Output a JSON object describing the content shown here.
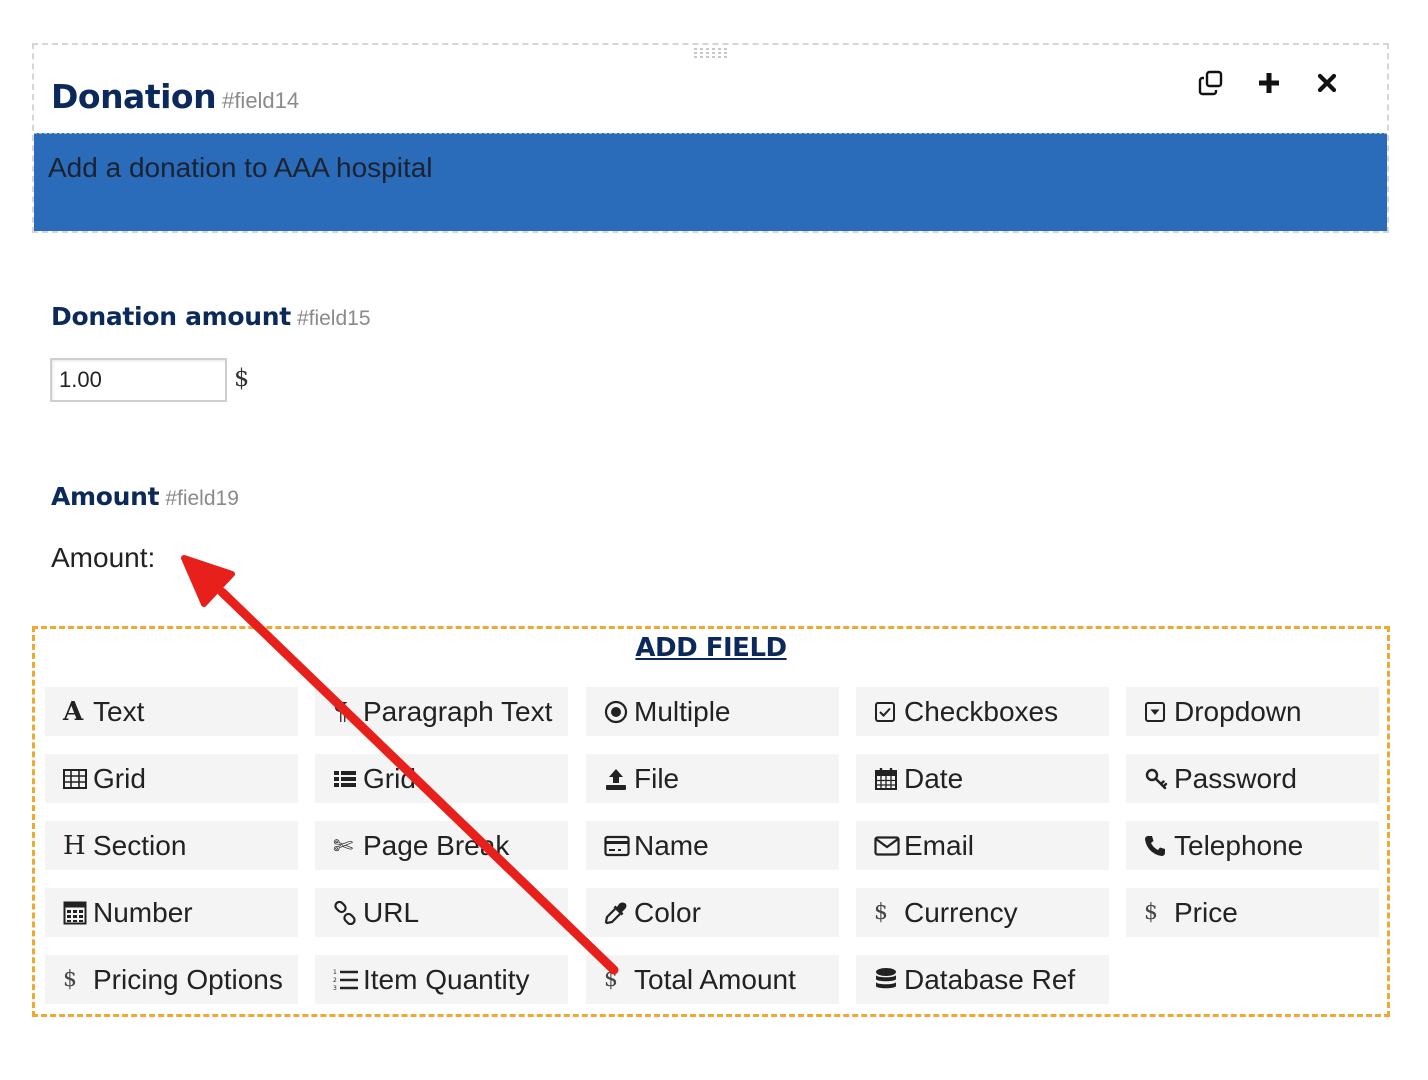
{
  "section": {
    "title": "Donation",
    "field_id": "#field14",
    "description": "Add a donation to AAA hospital",
    "actions": [
      "duplicate-icon",
      "plus-icon",
      "close-icon"
    ]
  },
  "fields": [
    {
      "label": "Donation amount",
      "field_id": "#field15",
      "value": "1.00",
      "currency_symbol": "$"
    },
    {
      "label": "Amount",
      "field_id": "#field19",
      "text": "Amount:"
    }
  ],
  "add_field": {
    "title": "ADD FIELD",
    "buttons": [
      {
        "label": "Text",
        "icon": "text-icon"
      },
      {
        "label": "Paragraph Text",
        "icon": "paragraph-icon"
      },
      {
        "label": "Multiple",
        "icon": "radio-icon"
      },
      {
        "label": "Checkboxes",
        "icon": "checkbox-icon"
      },
      {
        "label": "Dropdown",
        "icon": "dropdown-icon"
      },
      {
        "label": "Grid",
        "icon": "grid-icon"
      },
      {
        "label": "Grid",
        "icon": "grid-list-icon"
      },
      {
        "label": "File",
        "icon": "upload-icon"
      },
      {
        "label": "Date",
        "icon": "calendar-icon"
      },
      {
        "label": "Password",
        "icon": "key-icon"
      },
      {
        "label": "Section",
        "icon": "heading-icon"
      },
      {
        "label": "Page Break",
        "icon": "scissors-icon"
      },
      {
        "label": "Name",
        "icon": "id-card-icon"
      },
      {
        "label": "Email",
        "icon": "envelope-icon"
      },
      {
        "label": "Telephone",
        "icon": "phone-icon"
      },
      {
        "label": "Number",
        "icon": "calculator-icon"
      },
      {
        "label": "URL",
        "icon": "link-icon"
      },
      {
        "label": "Color",
        "icon": "eyedropper-icon"
      },
      {
        "label": "Currency",
        "icon": "dollar-icon"
      },
      {
        "label": "Price",
        "icon": "dollar-icon"
      },
      {
        "label": "Pricing Options",
        "icon": "dollar-icon"
      },
      {
        "label": "Item Quantity",
        "icon": "ordered-list-icon"
      },
      {
        "label": "Total Amount",
        "icon": "dollar-icon"
      },
      {
        "label": "Database Ref",
        "icon": "database-icon"
      }
    ]
  },
  "colors": {
    "title_navy": "#0b2a5b",
    "section_bar_blue": "#2a6bba",
    "panel_border_orange": "#f0a830",
    "button_bg": "#f4f4f4",
    "arrow_red": "#e8201c"
  }
}
